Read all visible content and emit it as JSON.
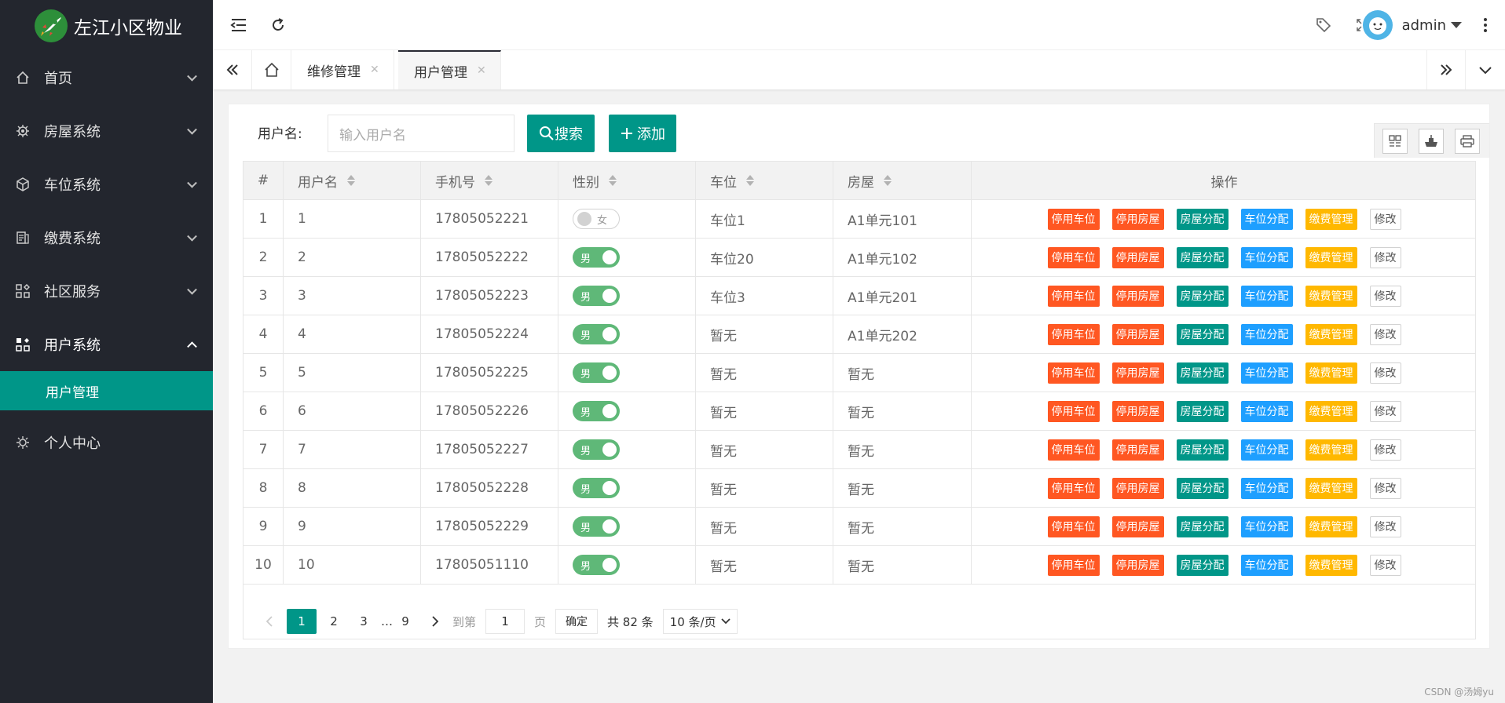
{
  "app": {
    "title": "左江小区物业"
  },
  "sidebar": {
    "items": [
      {
        "label": "首页",
        "icon": "home-icon"
      },
      {
        "label": "房屋系统",
        "icon": "gear-icon"
      },
      {
        "label": "车位系统",
        "icon": "cube-icon"
      },
      {
        "label": "缴费系统",
        "icon": "bill-icon"
      },
      {
        "label": "社区服务",
        "icon": "apps-icon"
      },
      {
        "label": "用户系统",
        "icon": "apps-icon"
      },
      {
        "label": "个人中心",
        "icon": "settings-icon"
      }
    ],
    "sub_active": "用户管理"
  },
  "header": {
    "user": "admin"
  },
  "tabs": [
    {
      "label": "维修管理"
    },
    {
      "label": "用户管理"
    }
  ],
  "toolbar": {
    "search_label": "用户名:",
    "search_placeholder": "输入用户名",
    "search_button": "搜索",
    "add_button": "添加"
  },
  "table": {
    "columns": [
      "#",
      "用户名",
      "手机号",
      "性别",
      "车位",
      "房屋",
      "操作"
    ],
    "actions": [
      "停用车位",
      "停用房屋",
      "房屋分配",
      "车位分配",
      "缴费管理",
      "修改"
    ],
    "rows": [
      {
        "idx": "1",
        "name": "1",
        "phone": "17805052221",
        "sex": "女",
        "sex_on": false,
        "park": "车位1",
        "house": "A1单元101"
      },
      {
        "idx": "2",
        "name": "2",
        "phone": "17805052222",
        "sex": "男",
        "sex_on": true,
        "park": "车位20",
        "house": "A1单元102"
      },
      {
        "idx": "3",
        "name": "3",
        "phone": "17805052223",
        "sex": "男",
        "sex_on": true,
        "park": "车位3",
        "house": "A1单元201"
      },
      {
        "idx": "4",
        "name": "4",
        "phone": "17805052224",
        "sex": "男",
        "sex_on": true,
        "park": "暂无",
        "house": "A1单元202"
      },
      {
        "idx": "5",
        "name": "5",
        "phone": "17805052225",
        "sex": "男",
        "sex_on": true,
        "park": "暂无",
        "house": "暂无"
      },
      {
        "idx": "6",
        "name": "6",
        "phone": "17805052226",
        "sex": "男",
        "sex_on": true,
        "park": "暂无",
        "house": "暂无"
      },
      {
        "idx": "7",
        "name": "7",
        "phone": "17805052227",
        "sex": "男",
        "sex_on": true,
        "park": "暂无",
        "house": "暂无"
      },
      {
        "idx": "8",
        "name": "8",
        "phone": "17805052228",
        "sex": "男",
        "sex_on": true,
        "park": "暂无",
        "house": "暂无"
      },
      {
        "idx": "9",
        "name": "9",
        "phone": "17805052229",
        "sex": "男",
        "sex_on": true,
        "park": "暂无",
        "house": "暂无"
      },
      {
        "idx": "10",
        "name": "10",
        "phone": "17805051110",
        "sex": "男",
        "sex_on": true,
        "park": "暂无",
        "house": "暂无"
      }
    ]
  },
  "pagination": {
    "pages": [
      "1",
      "2",
      "3",
      "…",
      "9"
    ],
    "goto_label": "到第",
    "goto_value": "1",
    "page_unit": "页",
    "confirm": "确定",
    "total": "共 82 条",
    "per_page": "10 条/页"
  },
  "watermark": "CSDN @汤姆yu",
  "colors": {
    "sidebar": "#23262e",
    "accent": "#009688",
    "red": "#ff5722",
    "blue": "#1e9fff",
    "yellow": "#ffb800",
    "switch_on": "#5fb878"
  }
}
